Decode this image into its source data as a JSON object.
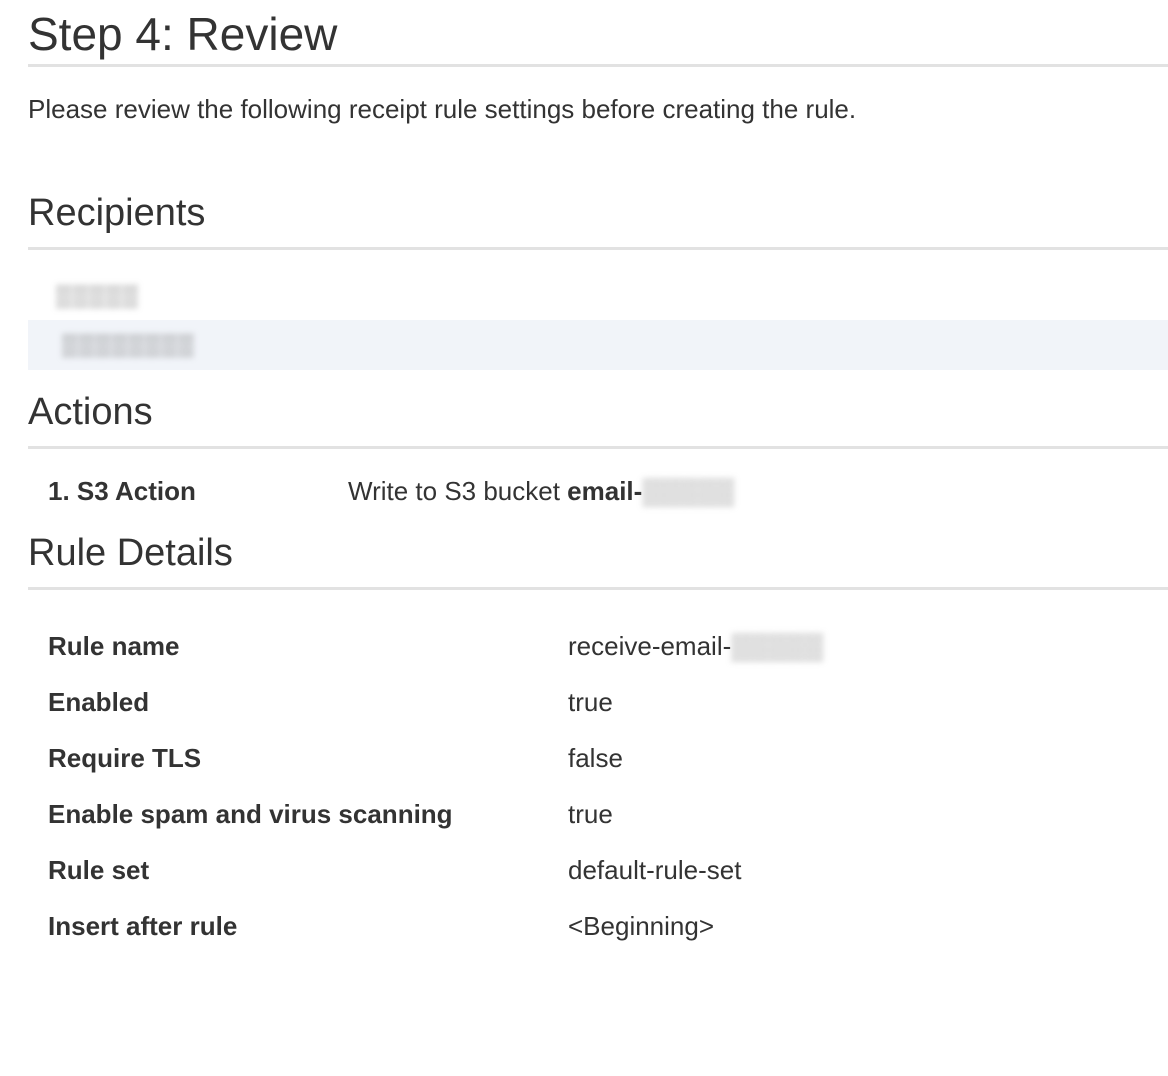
{
  "step": {
    "title": "Step 4: Review",
    "intro": "Please review the following receipt rule settings before creating the rule."
  },
  "recipients": {
    "title": "Recipients",
    "items": [
      {
        "value": "▒▒▒▒▒"
      },
      {
        "value": "▒▒▒▒▒▒▒▒"
      }
    ]
  },
  "actions": {
    "title": "Actions",
    "items": [
      {
        "name": "1. S3 Action",
        "desc_prefix": "Write to S3 bucket ",
        "bucket_prefix": "email-",
        "bucket_redacted": "▒▒▒▒▒"
      }
    ]
  },
  "rule_details": {
    "title": "Rule Details",
    "rows": [
      {
        "label": "Rule name",
        "value": "receive-email-",
        "redacted": "▒▒▒▒▒"
      },
      {
        "label": "Enabled",
        "value": "true"
      },
      {
        "label": "Require TLS",
        "value": "false"
      },
      {
        "label": "Enable spam and virus scanning",
        "value": "true"
      },
      {
        "label": "Rule set",
        "value": "default-rule-set"
      },
      {
        "label": "Insert after rule",
        "value": "<Beginning>"
      }
    ]
  }
}
